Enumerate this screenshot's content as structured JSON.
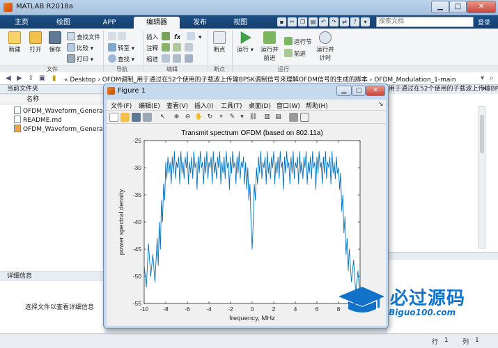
{
  "window": {
    "title": "MATLAB R2018a"
  },
  "tabs": [
    "主页",
    "绘图",
    "APP",
    "编辑器",
    "发布",
    "视图"
  ],
  "search": {
    "placeholder": "搜索文档"
  },
  "login": "登录",
  "ribbon": {
    "file": {
      "new": "新建",
      "open": "打开",
      "save": "保存",
      "find_files": "查找文件",
      "compare": "比较",
      "print": "打印",
      "label": "文件"
    },
    "navigate": {
      "goto": "转至",
      "find": "查找",
      "label": "导航"
    },
    "edit": {
      "insert": "插入",
      "comment": "注释",
      "indent": "缩进",
      "fx": "fx",
      "label": "编辑"
    },
    "breakpoints": {
      "breakpoints": "断点",
      "label": "断点"
    },
    "run": {
      "run": "运行",
      "run_advance": "运行并前进",
      "run_section": "运行节",
      "advance": "前进",
      "run_time": "运行并计时",
      "label": "运行"
    }
  },
  "address": {
    "path": "« Desktop › OFDM调制_用于通过在52个使用的子载波上传输BPSK调制信号来理解OFDM信号的生成的脚本 › OFDM_Modulation_1-main"
  },
  "current_folder": {
    "title": "当前文件夹",
    "column": "名称",
    "files": [
      "OFDM_Waveform_Generatio",
      "README.md",
      "OFDM_Waveform_Generatio"
    ]
  },
  "details": {
    "title": "详细信息",
    "empty_text": "选择文件以查看详细信息"
  },
  "bg_header_text": "用于通过在52个使用的子载波上传输BPSK调制...",
  "status": {
    "row_label": "行",
    "row": "1",
    "col_label": "列",
    "col": "1"
  },
  "figure": {
    "title": "Figure 1",
    "menu": [
      "文件(F)",
      "编辑(E)",
      "查看(V)",
      "插入(I)",
      "工具(T)",
      "桌面(D)",
      "窗口(W)",
      "帮助(H)"
    ]
  },
  "chart_data": {
    "type": "line",
    "title": "Transmit spectrum OFDM (based on 802.11a)",
    "xlabel": "frequency, MHz",
    "ylabel": "power spectral density",
    "xlim": [
      -10,
      10
    ],
    "ylim": [
      -55,
      -25
    ],
    "xticks": [
      -10,
      -8,
      -6,
      -4,
      -2,
      0,
      2,
      4,
      6,
      8,
      10
    ],
    "yticks": [
      -55,
      -50,
      -45,
      -40,
      -35,
      -30,
      -25
    ],
    "color": "#0072BD",
    "grid": false,
    "series": [
      {
        "description": "Approximate PSD envelope samples (frequency MHz, dB)",
        "points": [
          [
            -10,
            -48
          ],
          [
            -9.8,
            -52
          ],
          [
            -9.6,
            -44
          ],
          [
            -9.4,
            -50
          ],
          [
            -9.2,
            -46
          ],
          [
            -9.0,
            -51
          ],
          [
            -8.8,
            -43
          ],
          [
            -8.7,
            -48
          ],
          [
            -8.6,
            -40
          ],
          [
            -8.5,
            -45
          ],
          [
            -8.4,
            -36
          ],
          [
            -8.3,
            -40
          ],
          [
            -8.2,
            -33
          ],
          [
            -8.1,
            -36
          ],
          [
            -8.0,
            -29
          ],
          [
            -7.9,
            -32
          ],
          [
            -7.8,
            -28
          ],
          [
            -7.7,
            -31
          ],
          [
            -7.6,
            -29
          ],
          [
            -7.5,
            -33
          ],
          [
            -7.4,
            -28
          ],
          [
            -7.3,
            -31
          ],
          [
            -7.2,
            -27
          ],
          [
            -7.1,
            -32
          ],
          [
            -7.0,
            -29
          ],
          [
            -6.9,
            -30
          ],
          [
            -6.8,
            -28
          ],
          [
            -6.7,
            -33
          ],
          [
            -6.6,
            -27
          ],
          [
            -6.5,
            -31
          ],
          [
            -6.4,
            -29
          ],
          [
            -6.3,
            -32
          ],
          [
            -6.2,
            -28
          ],
          [
            -6.1,
            -30
          ],
          [
            -6.0,
            -27
          ],
          [
            -5.9,
            -33
          ],
          [
            -5.8,
            -29
          ],
          [
            -5.7,
            -31
          ],
          [
            -5.6,
            -28
          ],
          [
            -5.5,
            -32
          ],
          [
            -5.4,
            -27
          ],
          [
            -5.3,
            -30
          ],
          [
            -5.2,
            -29
          ],
          [
            -5.1,
            -34
          ],
          [
            -5.0,
            -28
          ],
          [
            -4.9,
            -31
          ],
          [
            -4.8,
            -27
          ],
          [
            -4.7,
            -30
          ],
          [
            -4.6,
            -29
          ],
          [
            -4.5,
            -33
          ],
          [
            -4.4,
            -28
          ],
          [
            -4.3,
            -31
          ],
          [
            -4.2,
            -27
          ],
          [
            -4.1,
            -32
          ],
          [
            -4.0,
            -29
          ],
          [
            -3.9,
            -30
          ],
          [
            -3.8,
            -28
          ],
          [
            -3.7,
            -33
          ],
          [
            -3.6,
            -27
          ],
          [
            -3.5,
            -31
          ],
          [
            -3.4,
            -29
          ],
          [
            -3.3,
            -32
          ],
          [
            -3.2,
            -28
          ],
          [
            -3.1,
            -30
          ],
          [
            -3.0,
            -27
          ],
          [
            -2.9,
            -33
          ],
          [
            -2.8,
            -29
          ],
          [
            -2.7,
            -31
          ],
          [
            -2.6,
            -28
          ],
          [
            -2.5,
            -32
          ],
          [
            -2.4,
            -27
          ],
          [
            -2.3,
            -30
          ],
          [
            -2.2,
            -29
          ],
          [
            -2.1,
            -34
          ],
          [
            -2.0,
            -28
          ],
          [
            -1.9,
            -31
          ],
          [
            -1.8,
            -27
          ],
          [
            -1.7,
            -30
          ],
          [
            -1.6,
            -29
          ],
          [
            -1.5,
            -33
          ],
          [
            -1.4,
            -28
          ],
          [
            -1.3,
            -31
          ],
          [
            -1.2,
            -27
          ],
          [
            -1.1,
            -32
          ],
          [
            -1.0,
            -29
          ],
          [
            -0.9,
            -30
          ],
          [
            -0.8,
            -28
          ],
          [
            -0.7,
            -33
          ],
          [
            -0.6,
            -29
          ],
          [
            -0.5,
            -34
          ],
          [
            -0.4,
            -30
          ],
          [
            -0.3,
            -36
          ],
          [
            -0.2,
            -33
          ],
          [
            -0.1,
            -40
          ],
          [
            0.0,
            -45
          ],
          [
            0.1,
            -40
          ],
          [
            0.2,
            -33
          ],
          [
            0.3,
            -36
          ],
          [
            0.4,
            -30
          ],
          [
            0.5,
            -33
          ],
          [
            0.6,
            -28
          ],
          [
            0.7,
            -31
          ],
          [
            0.8,
            -27
          ],
          [
            0.9,
            -32
          ],
          [
            1.0,
            -29
          ],
          [
            1.1,
            -30
          ],
          [
            1.2,
            -28
          ],
          [
            1.3,
            -33
          ],
          [
            1.4,
            -27
          ],
          [
            1.5,
            -31
          ],
          [
            1.6,
            -29
          ],
          [
            1.7,
            -32
          ],
          [
            1.8,
            -28
          ],
          [
            1.9,
            -30
          ],
          [
            2.0,
            -27
          ],
          [
            2.1,
            -33
          ],
          [
            2.2,
            -29
          ],
          [
            2.3,
            -31
          ],
          [
            2.4,
            -28
          ],
          [
            2.5,
            -32
          ],
          [
            2.6,
            -27
          ],
          [
            2.7,
            -30
          ],
          [
            2.8,
            -29
          ],
          [
            2.9,
            -34
          ],
          [
            3.0,
            -28
          ],
          [
            3.1,
            -31
          ],
          [
            3.2,
            -27
          ],
          [
            3.3,
            -30
          ],
          [
            3.4,
            -29
          ],
          [
            3.5,
            -33
          ],
          [
            3.6,
            -28
          ],
          [
            3.7,
            -31
          ],
          [
            3.8,
            -27
          ],
          [
            3.9,
            -32
          ],
          [
            4.0,
            -29
          ],
          [
            4.1,
            -30
          ],
          [
            4.2,
            -28
          ],
          [
            4.3,
            -33
          ],
          [
            4.4,
            -27
          ],
          [
            4.5,
            -31
          ],
          [
            4.6,
            -29
          ],
          [
            4.7,
            -32
          ],
          [
            4.8,
            -28
          ],
          [
            4.9,
            -30
          ],
          [
            5.0,
            -27
          ],
          [
            5.1,
            -33
          ],
          [
            5.2,
            -29
          ],
          [
            5.3,
            -31
          ],
          [
            5.4,
            -28
          ],
          [
            5.5,
            -32
          ],
          [
            5.6,
            -27
          ],
          [
            5.7,
            -30
          ],
          [
            5.8,
            -29
          ],
          [
            5.9,
            -34
          ],
          [
            6.0,
            -28
          ],
          [
            6.1,
            -31
          ],
          [
            6.2,
            -27
          ],
          [
            6.3,
            -30
          ],
          [
            6.4,
            -29
          ],
          [
            6.5,
            -33
          ],
          [
            6.6,
            -28
          ],
          [
            6.7,
            -31
          ],
          [
            6.8,
            -27
          ],
          [
            6.9,
            -32
          ],
          [
            7.0,
            -29
          ],
          [
            7.1,
            -30
          ],
          [
            7.2,
            -28
          ],
          [
            7.3,
            -33
          ],
          [
            7.4,
            -27
          ],
          [
            7.5,
            -31
          ],
          [
            7.6,
            -29
          ],
          [
            7.7,
            -32
          ],
          [
            7.8,
            -28
          ],
          [
            7.9,
            -31
          ],
          [
            8.0,
            -30
          ],
          [
            8.1,
            -34
          ],
          [
            8.2,
            -31
          ],
          [
            8.3,
            -38
          ],
          [
            8.4,
            -35
          ],
          [
            8.5,
            -42
          ],
          [
            8.6,
            -39
          ],
          [
            8.7,
            -46
          ],
          [
            8.8,
            -43
          ],
          [
            8.9,
            -49
          ],
          [
            9.0,
            -45
          ],
          [
            9.2,
            -51
          ],
          [
            9.4,
            -47
          ],
          [
            9.6,
            -53
          ],
          [
            9.8,
            -49
          ],
          [
            10,
            -54
          ]
        ]
      }
    ]
  }
}
